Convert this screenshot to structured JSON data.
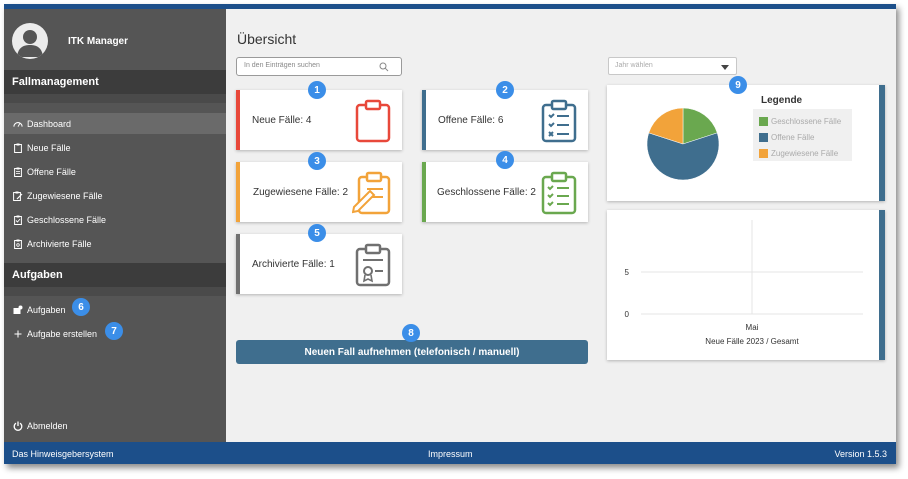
{
  "user": {
    "name": "ITK Manager"
  },
  "sidebar": {
    "section_cases": "Fallmanagement",
    "items": [
      {
        "label": "Dashboard",
        "icon": "gauge-icon",
        "active": true
      },
      {
        "label": "Neue Fälle",
        "icon": "clipboard-icon"
      },
      {
        "label": "Offene Fälle",
        "icon": "clipboard-list-icon"
      },
      {
        "label": "Zugewiesene Fälle",
        "icon": "clipboard-edit-icon"
      },
      {
        "label": "Geschlossene Fälle",
        "icon": "clipboard-check-icon"
      },
      {
        "label": "Archivierte Fälle",
        "icon": "clipboard-archive-icon"
      }
    ],
    "section_tasks": "Aufgaben",
    "task_items": [
      {
        "label": "Aufgaben",
        "icon": "tasks-icon"
      },
      {
        "label": "Aufgabe erstellen",
        "icon": "plus-icon"
      }
    ],
    "logout": "Abmelden"
  },
  "main": {
    "title": "Übersicht",
    "search_placeholder": "In den Einträgen suchen",
    "year_select": "Jahr wählen",
    "cards": [
      {
        "label": "Neue Fälle: 4",
        "color": "#e8483a",
        "icon": "clipboard-icon"
      },
      {
        "label": "Offene Fälle: 6",
        "color": "#3f6e8e",
        "icon": "clipboard-list-icon"
      },
      {
        "label": "Zugewiesene Fälle: 2",
        "color": "#f2a33a",
        "icon": "clipboard-edit-icon"
      },
      {
        "label": "Geschlossene Fälle: 2",
        "color": "#6aa84f",
        "icon": "clipboard-check-icon"
      },
      {
        "label": "Archivierte Fälle: 1",
        "color": "#707070",
        "icon": "clipboard-archive-icon"
      }
    ],
    "new_case_button": "Neuen Fall aufnehmen (telefonisch / manuell)"
  },
  "badges": [
    "1",
    "2",
    "3",
    "4",
    "5",
    "6",
    "7",
    "8",
    "9"
  ],
  "chart_data": [
    {
      "type": "pie",
      "legend_title": "Legende",
      "legend_position": "right",
      "categories": [
        "Geschlossene Fälle",
        "Offene Fälle",
        "Zugewiesene Fälle"
      ],
      "values": [
        2,
        6,
        2
      ],
      "colors": [
        "#6aa84f",
        "#3f6e8e",
        "#f2a33a"
      ]
    },
    {
      "type": "bar",
      "categories": [
        "Mai"
      ],
      "values": [
        0
      ],
      "xlabel": "Neue Fälle 2023 / Gesamt",
      "yticks": [
        "5",
        "0"
      ],
      "ylim": [
        0,
        10
      ],
      "grid": true
    }
  ],
  "footer": {
    "left": "Das Hinweisgebersystem",
    "center": "Impressum",
    "right": "Version 1.5.3"
  }
}
